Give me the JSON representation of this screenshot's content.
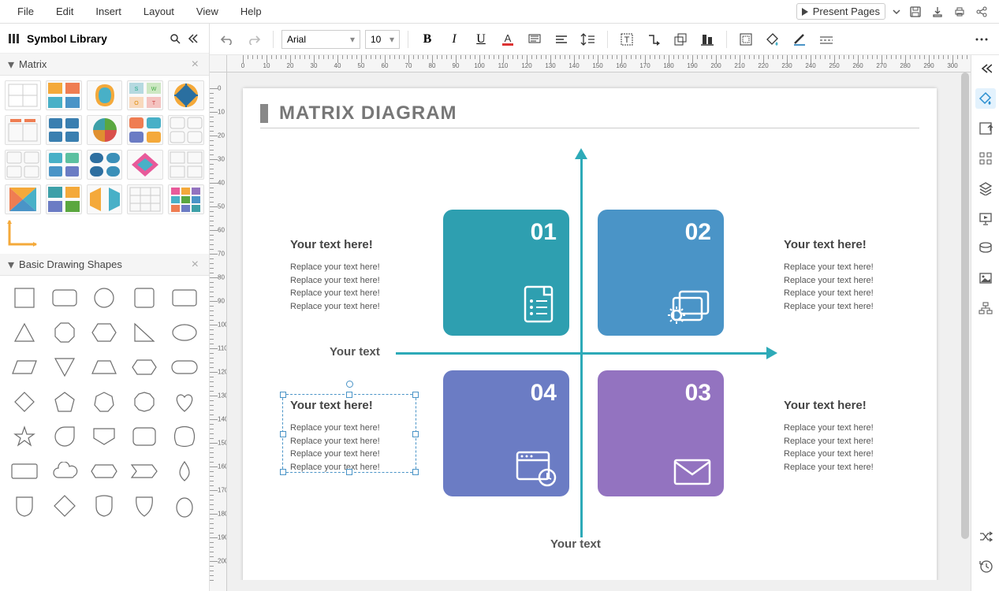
{
  "menu": {
    "file": "File",
    "edit": "Edit",
    "insert": "Insert",
    "layout": "Layout",
    "view": "View",
    "help": "Help",
    "present": "Present Pages"
  },
  "sidebar": {
    "title": "Symbol Library",
    "sections": {
      "matrix": "Matrix",
      "basic": "Basic Drawing Shapes"
    }
  },
  "toolbar": {
    "font": "Arial",
    "size": "10"
  },
  "ruler": {
    "h": [
      "0",
      "10",
      "20",
      "30",
      "40",
      "50",
      "60",
      "70",
      "80",
      "90",
      "100",
      "110",
      "120",
      "130",
      "140",
      "150",
      "160",
      "170",
      "180",
      "190",
      "200",
      "210",
      "220",
      "230",
      "240",
      "250",
      "260",
      "270",
      "280",
      "290",
      "300"
    ],
    "v": [
      "0",
      "10",
      "20",
      "30",
      "40",
      "50",
      "60",
      "70",
      "80",
      "90",
      "100",
      "110",
      "120",
      "130",
      "140",
      "150",
      "160",
      "170",
      "180",
      "190",
      "200"
    ]
  },
  "page": {
    "title": "MATRIX DIAGRAM",
    "axis_x_label": "Your text",
    "axis_y_label": "Your text",
    "quads": {
      "q1": "01",
      "q2": "02",
      "q3": "03",
      "q4": "04"
    },
    "blocks": {
      "b1": {
        "head": "Your text here!",
        "l1": "Replace your text here!",
        "l2": "Replace your text here!",
        "l3": "Replace your text here!",
        "l4": "Replace your text here!"
      },
      "b2": {
        "head": "Your text here!",
        "l1": "Replace your text here!",
        "l2": "Replace your text here!",
        "l3": "Replace your text here!",
        "l4": "Replace your text here!"
      },
      "b3": {
        "head": "Your text here!",
        "l1": "Replace your text here!",
        "l2": "Replace your text here!",
        "l3": "Replace your text here!",
        "l4": "Replace your text here!"
      },
      "b4": {
        "head": "Your text here!",
        "l1": "Replace your text here!",
        "l2": "Replace your text here!",
        "l3": "Replace your text here!",
        "l4": "Replace your text here!"
      }
    }
  }
}
